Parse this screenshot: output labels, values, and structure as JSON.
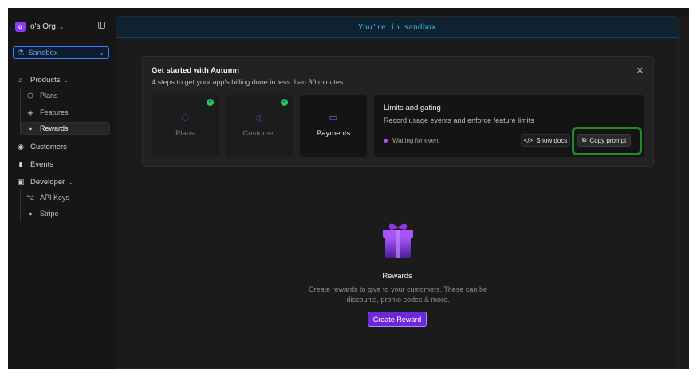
{
  "sidebar": {
    "org": {
      "badge": "o",
      "name": "o's Org",
      "chevron": "⌄"
    },
    "env": {
      "label": "Sandbox"
    },
    "items": [
      {
        "label": "Products",
        "icon": "⌂",
        "icon_name": "package-icon"
      },
      {
        "label": "Plans",
        "icon": "⬡",
        "icon_name": "cube-icon"
      },
      {
        "label": "Features",
        "icon": "◈",
        "icon_name": "puzzle-icon"
      },
      {
        "label": "Rewards",
        "icon": "●",
        "icon_name": "tag-icon"
      },
      {
        "label": "Customers",
        "icon": "◉",
        "icon_name": "user-circle-icon"
      },
      {
        "label": "Events",
        "icon": "▮",
        "icon_name": "bar-chart-icon"
      },
      {
        "label": "Developer",
        "icon": "▣",
        "icon_name": "terminal-icon"
      },
      {
        "label": "API Keys",
        "icon": "⌥",
        "icon_name": "key-icon"
      },
      {
        "label": "Stripe",
        "icon": "●",
        "icon_name": "stripe-icon"
      }
    ]
  },
  "banner": {
    "text": "You're in sandbox"
  },
  "onboarding": {
    "title": "Get started with Autumn",
    "subtitle": "4 steps to get your app's billing done in less than 30 minutes",
    "close": "✕",
    "steps": [
      {
        "label": "Plans",
        "icon": "⬡",
        "done": true
      },
      {
        "label": "Customer",
        "icon": "◎",
        "done": true
      },
      {
        "label": "Payments",
        "icon": "▭",
        "done": false
      }
    ],
    "detail": {
      "title": "Limits and gating",
      "subtitle": "Record usage events and enforce feature limits",
      "status": "Waiting for event",
      "show_docs": "Show docs",
      "copy_prompt": "Copy prompt"
    }
  },
  "empty_state": {
    "title": "Rewards",
    "description": "Create rewards to give to your customers. These can be discounts, promo codes & more.",
    "button": "Create Reward"
  },
  "colors": {
    "accent": "#8b3cf7",
    "sandbox_blue": "#3b82f6",
    "success": "#22c55e",
    "highlight": "#1f8a2e"
  }
}
